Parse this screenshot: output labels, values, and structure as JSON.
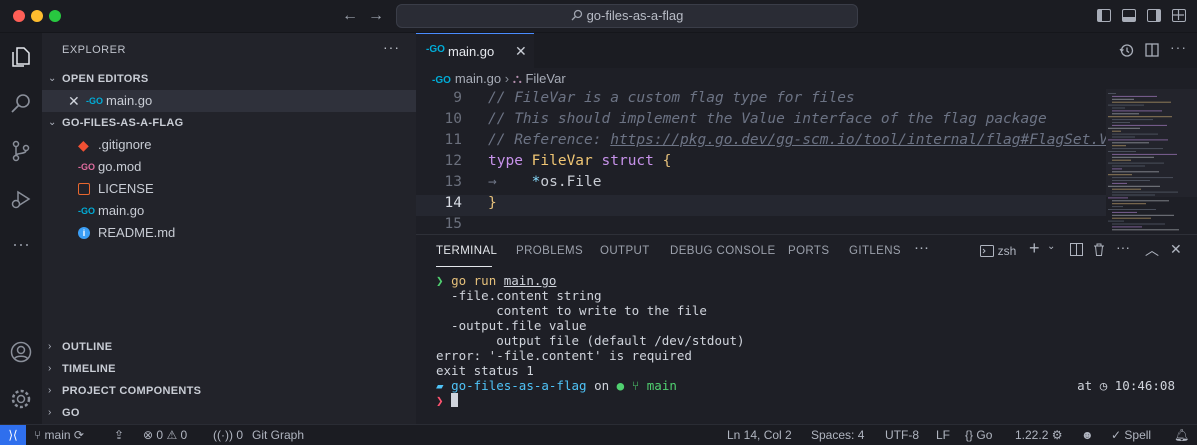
{
  "window": {
    "search_text": "go-files-as-a-flag"
  },
  "sidebar": {
    "title": "EXPLORER",
    "more": "···",
    "open_editors_header": "OPEN EDITORS",
    "open_editors": [
      {
        "name": "main.go",
        "icon": "go-file-icon",
        "icon_text": "-GO"
      }
    ],
    "project_header": "GO-FILES-AS-A-FLAG",
    "files": [
      {
        "name": ".gitignore",
        "icon": "git-icon",
        "icon_color": "#f05033"
      },
      {
        "name": "go.mod",
        "icon": "go-mod-icon",
        "icon_text": "-GO",
        "icon_color": "#e06c9f"
      },
      {
        "name": "LICENSE",
        "icon": "license-icon",
        "icon_color": "#e8672f"
      },
      {
        "name": "main.go",
        "icon": "go-file-icon",
        "icon_text": "-GO",
        "icon_color": "#00add8"
      },
      {
        "name": "README.md",
        "icon": "info-icon",
        "icon_color": "#3b9ef5"
      }
    ],
    "collapsed_sections": [
      "OUTLINE",
      "TIMELINE",
      "PROJECT COMPONENTS",
      "GO"
    ]
  },
  "editor": {
    "tab_label": "main.go",
    "tab_icon_text": "-GO",
    "breadcrumb": [
      "main.go",
      "FileVar"
    ],
    "lines": [
      {
        "num": "9",
        "tokens": [
          {
            "c": "cmt",
            "t": "// FileVar is a custom flag type for files"
          }
        ]
      },
      {
        "num": "10",
        "tokens": [
          {
            "c": "cmt",
            "t": "// This should implement the Value interface of the flag package"
          }
        ]
      },
      {
        "num": "11",
        "tokens": [
          {
            "c": "cmt",
            "t": "// Reference: "
          },
          {
            "c": "cmt-link",
            "t": "https://pkg.go.dev/gg-scm.io/tool/internal/flag#FlagSet.Var"
          }
        ]
      },
      {
        "num": "12",
        "tokens": [
          {
            "c": "kw",
            "t": "type "
          },
          {
            "c": "ty",
            "t": "FileVar "
          },
          {
            "c": "kw",
            "t": "struct "
          },
          {
            "c": "br",
            "t": "{"
          }
        ]
      },
      {
        "num": "13",
        "tokens": [
          {
            "c": "ind",
            "t": "→    "
          },
          {
            "c": "op",
            "t": "*"
          },
          {
            "c": "id",
            "t": "os.File"
          }
        ]
      },
      {
        "num": "14",
        "tokens": [
          {
            "c": "br",
            "t": "}"
          }
        ]
      },
      {
        "num": "15",
        "tokens": []
      }
    ]
  },
  "panel": {
    "tabs": [
      "TERMINAL",
      "PROBLEMS",
      "OUTPUT",
      "DEBUG CONSOLE",
      "PORTS",
      "GITLENS"
    ],
    "active_tab": "TERMINAL",
    "shell": "zsh",
    "terminal": {
      "prompt_symbol": "❯",
      "command_go": "go run ",
      "command_file": "main.go",
      "output_lines": [
        "  -file.content string",
        "        content to write to the file",
        "  -output.file value",
        "        output file (default /dev/stdout)",
        "error: '-file.content' is required",
        "exit status 1"
      ],
      "dir": "go-files-as-a-flag",
      "on_text": "on",
      "branch": "main",
      "time_prefix": "at",
      "time": "10:46:08"
    }
  },
  "statusbar": {
    "branch": "main",
    "errors": "0",
    "warnings": "0",
    "ports": "0",
    "git_graph": "Git Graph",
    "cursor_pos": "Ln 14, Col 2",
    "spaces": "Spaces: 4",
    "encoding": "UTF-8",
    "eol": "LF",
    "language": "Go",
    "go_version": "1.22.2",
    "spell": "Spell"
  }
}
